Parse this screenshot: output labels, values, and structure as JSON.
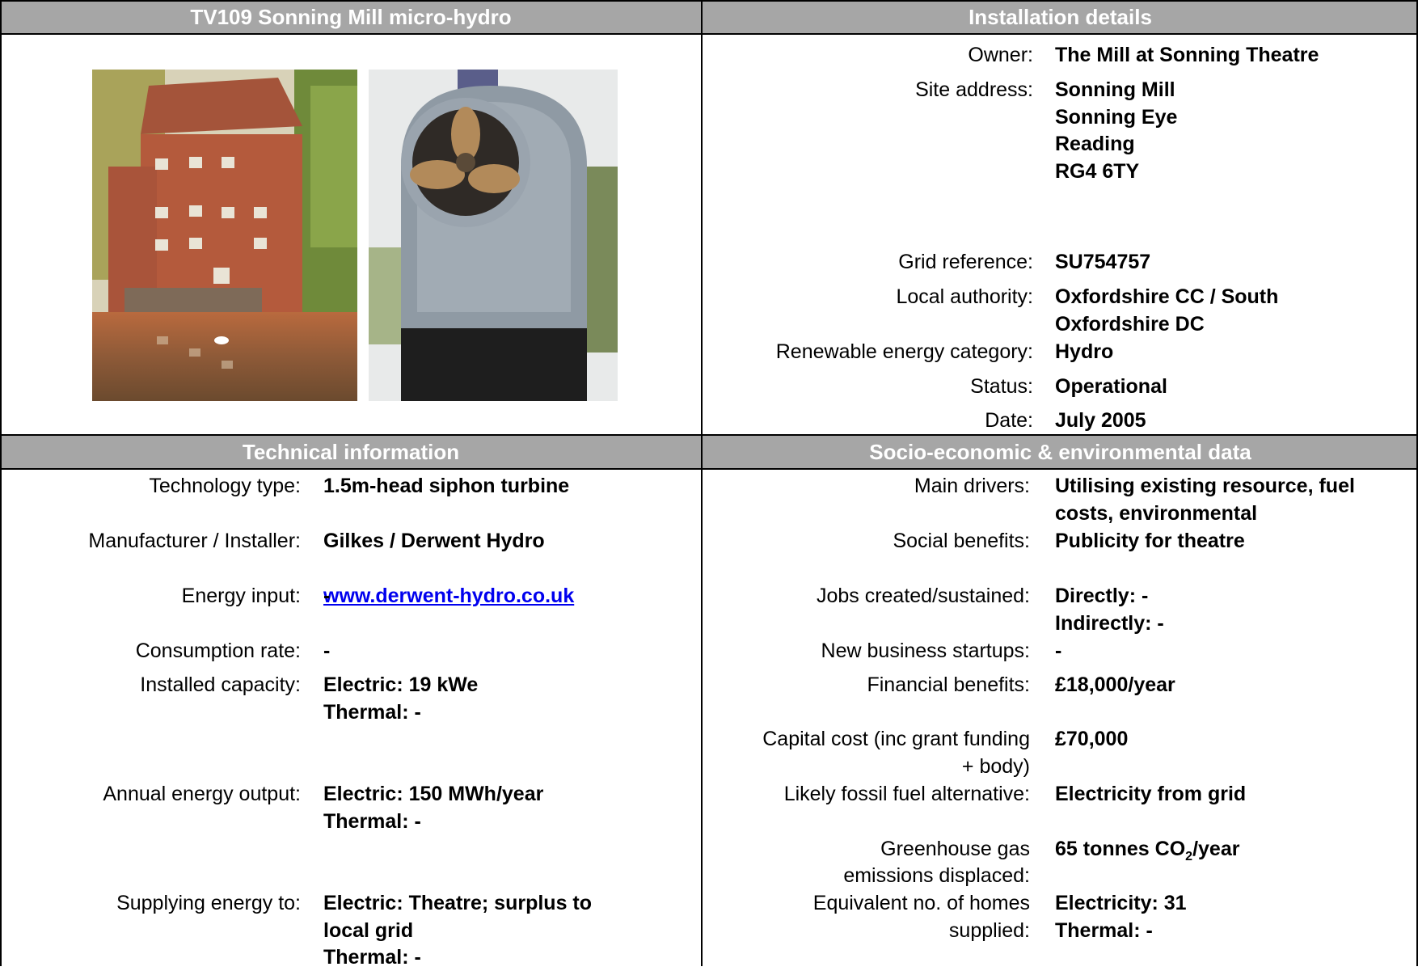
{
  "sections": {
    "project_title": "TV109 Sonning Mill micro-hydro",
    "installation": "Installation details",
    "technical": "Technical information",
    "socio": "Socio-economic & environmental data"
  },
  "installation": {
    "owner_label": "Owner:",
    "owner": "The Mill at Sonning Theatre",
    "address_label": "Site address:",
    "address_lines": [
      "Sonning Mill",
      "Sonning Eye",
      "Reading",
      "RG4 6TY"
    ],
    "grid_label": "Grid reference:",
    "grid": "SU754757",
    "authority_label": "Local authority:",
    "authority_lines": [
      "Oxfordshire CC / South",
      "Oxfordshire DC"
    ],
    "category_label": "Renewable energy category:",
    "category": "Hydro",
    "status_label": "Status:",
    "status": "Operational",
    "date_label": "Date:",
    "date": "July 2005"
  },
  "technical": {
    "tech_label": "Technology type:",
    "tech": "1.5m-head siphon turbine",
    "manu_label": "Manufacturer / Installer:",
    "manu": "Gilkes / Derwent Hydro",
    "manu_link": "www.derwent-hydro.co.uk",
    "input_label": "Energy input:",
    "input": "-",
    "consumption_label": "Consumption rate:",
    "consumption": "-",
    "capacity_label": "Installed capacity:",
    "capacity_lines": [
      "Electric: 19 kWe",
      "Thermal: -"
    ],
    "output_label": "Annual energy output:",
    "output_lines": [
      "Electric: 150 MWh/year",
      "Thermal: -"
    ],
    "supply_label": "Supplying energy to:",
    "supply_lines": [
      "Electric: Theatre; surplus to",
      "local grid",
      "Thermal: -"
    ]
  },
  "socio": {
    "drivers_label": "Main drivers:",
    "drivers_lines": [
      "Utilising existing resource, fuel",
      "costs, environmental"
    ],
    "social_label": "Social benefits:",
    "social": "Publicity for theatre",
    "jobs_label": "Jobs created/sustained:",
    "jobs_lines": [
      "Directly: -",
      "Indirectly: -"
    ],
    "startups_label": "New business startups:",
    "startups": "-",
    "financial_label": "Financial benefits:",
    "financial": "£18,000/year",
    "capital_label_lines": [
      "Capital cost (inc grant funding",
      "+ body)"
    ],
    "capital": "£70,000",
    "fossil_label": "Likely fossil fuel alternative:",
    "fossil": "Electricity from grid",
    "ghg_label_lines": [
      "Greenhouse gas",
      "emissions displaced:"
    ],
    "ghg_pre": "65 tonnes CO",
    "ghg_sub": "2",
    "ghg_post": "/year",
    "homes_label_lines": [
      "Equivalent no. of homes",
      "supplied:"
    ],
    "homes_lines": [
      "Electricity: 31",
      "Thermal: -"
    ]
  }
}
